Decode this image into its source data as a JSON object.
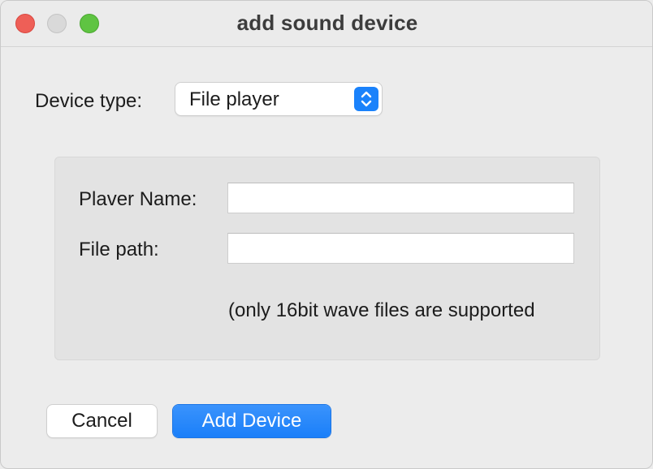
{
  "window": {
    "title": "add sound device"
  },
  "device_type": {
    "label": "Device type:",
    "selected": "File player"
  },
  "form": {
    "player_name_label": "Plaver Name:",
    "player_name_value": "",
    "file_path_label": "File path:",
    "file_path_value": "",
    "hint": "(only 16bit wave files are supported"
  },
  "buttons": {
    "cancel_label": "Cancel",
    "add_label": "Add Device"
  },
  "colors": {
    "accent": "#1a82fb",
    "close": "#ee5f57",
    "zoom": "#5fc442",
    "minimize": "#d9d9d9"
  },
  "icons": {
    "traffic_lights": [
      "close-icon",
      "minimize-icon",
      "zoom-icon"
    ],
    "select_stepper": "chevron-up-down-icon"
  }
}
